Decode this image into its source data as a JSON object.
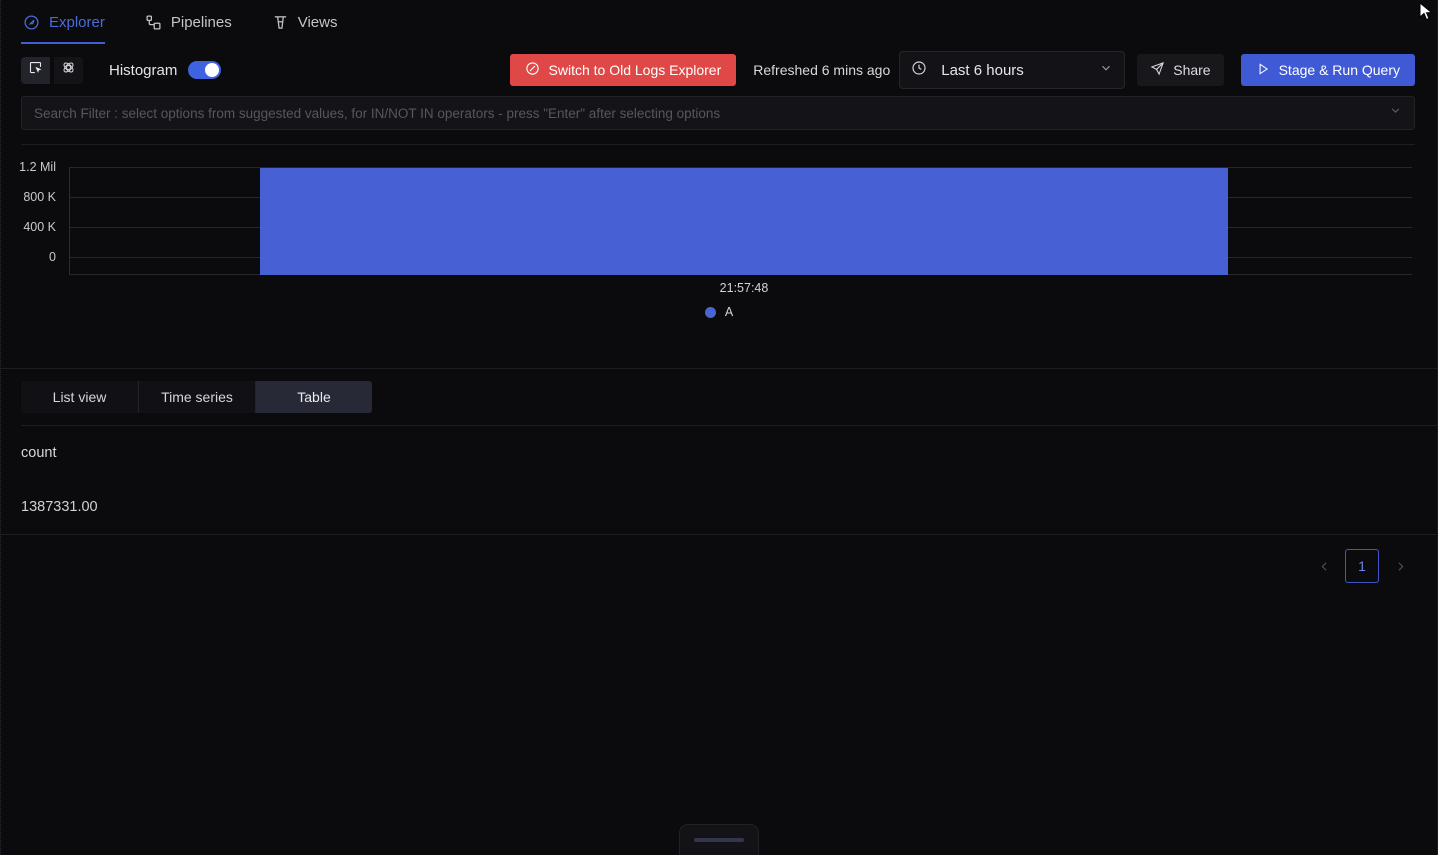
{
  "nav": {
    "items": [
      {
        "label": "Explorer",
        "icon": "compass-icon",
        "active": true
      },
      {
        "label": "Pipelines",
        "icon": "pipeline-icon",
        "active": false
      },
      {
        "label": "Views",
        "icon": "tower-icon",
        "active": false
      }
    ]
  },
  "toolbar": {
    "select_icon": "select-box-icon",
    "atom_icon": "atom-icon",
    "histogram_label": "Histogram",
    "histogram_on": true,
    "switch_old_label": "Switch to Old Logs Explorer",
    "switch_old_icon": "slash-circle-icon",
    "refreshed_label": "Refreshed 6 mins ago",
    "time_range": "Last 6 hours",
    "clock_icon": "clock-icon",
    "chevron_icon": "chevron-down-icon",
    "share_label": "Share",
    "share_icon": "send-icon",
    "run_label": "Stage & Run Query",
    "run_icon": "play-icon",
    "colors": {
      "danger": "#e04848",
      "primary": "#3f5ad4",
      "toggle_on": "#3f63e0"
    }
  },
  "search": {
    "value": "",
    "placeholder": "Search Filter : select options from suggested values, for IN/NOT IN operators - press \"Enter\" after selecting options",
    "chevron_icon": "chevron-down-icon"
  },
  "chart_data": {
    "type": "bar",
    "title": "",
    "xlabel": "",
    "ylabel": "",
    "categories": [
      "21:57:48"
    ],
    "values": [
      1387331
    ],
    "ylim": [
      0,
      1400000
    ],
    "yticks": [
      0,
      400000,
      800000,
      1200000
    ],
    "ytick_labels": [
      "0",
      "400 K",
      "800 K",
      "1.2 Mil"
    ],
    "xtick_labels": [
      "21:57:48"
    ],
    "grid": true,
    "legend": {
      "position": "bottom",
      "entries": [
        {
          "name": "A",
          "color": "#4a64d6"
        }
      ]
    },
    "series": [
      {
        "name": "A",
        "color": "#4761d4",
        "values": [
          1387331
        ]
      }
    ]
  },
  "view_tabs": {
    "items": [
      {
        "label": "List view",
        "active": false
      },
      {
        "label": "Time series",
        "active": false
      },
      {
        "label": "Table",
        "active": true
      }
    ]
  },
  "table": {
    "columns": [
      "count"
    ],
    "rows": [
      [
        "1387331.00"
      ]
    ]
  },
  "pagination": {
    "prev_icon": "chevron-left-icon",
    "next_icon": "chevron-right-icon",
    "current_page": "1"
  },
  "bottom": {
    "handle": "resize-grip"
  }
}
